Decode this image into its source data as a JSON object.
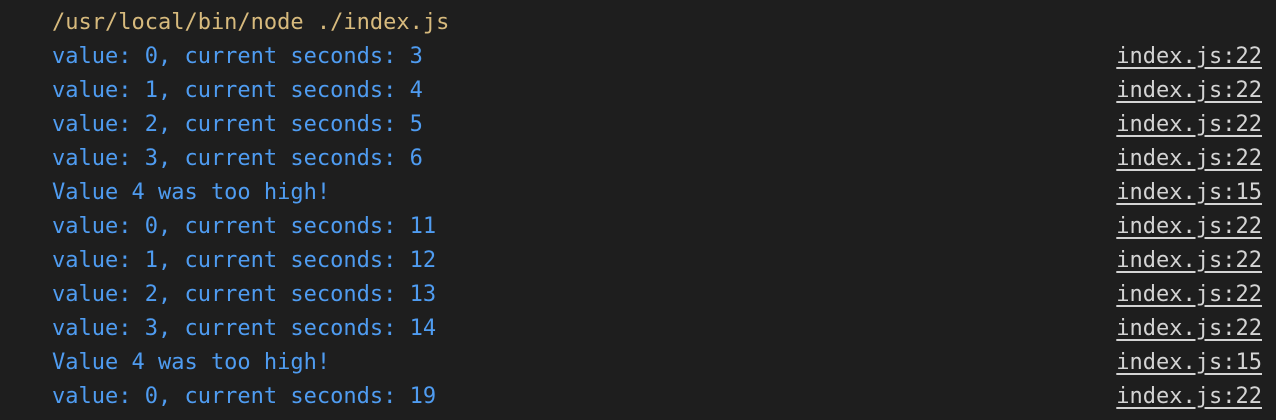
{
  "command": "/usr/local/bin/node ./index.js",
  "lines": [
    {
      "message": "value: 0, current seconds: 3",
      "source": "index.js:22"
    },
    {
      "message": "value: 1, current seconds: 4",
      "source": "index.js:22"
    },
    {
      "message": "value: 2, current seconds: 5",
      "source": "index.js:22"
    },
    {
      "message": "value: 3, current seconds: 6",
      "source": "index.js:22"
    },
    {
      "message": "Value 4 was too high!",
      "source": "index.js:15"
    },
    {
      "message": "value: 0, current seconds: 11",
      "source": "index.js:22"
    },
    {
      "message": "value: 1, current seconds: 12",
      "source": "index.js:22"
    },
    {
      "message": "value: 2, current seconds: 13",
      "source": "index.js:22"
    },
    {
      "message": "value: 3, current seconds: 14",
      "source": "index.js:22"
    },
    {
      "message": "Value 4 was too high!",
      "source": "index.js:15"
    },
    {
      "message": "value: 0, current seconds: 19",
      "source": "index.js:22"
    }
  ],
  "colors": {
    "background": "#1e1e1e",
    "command": "#d7ba7d",
    "message": "#4f9cf1",
    "source_link": "#d4d4d4"
  }
}
